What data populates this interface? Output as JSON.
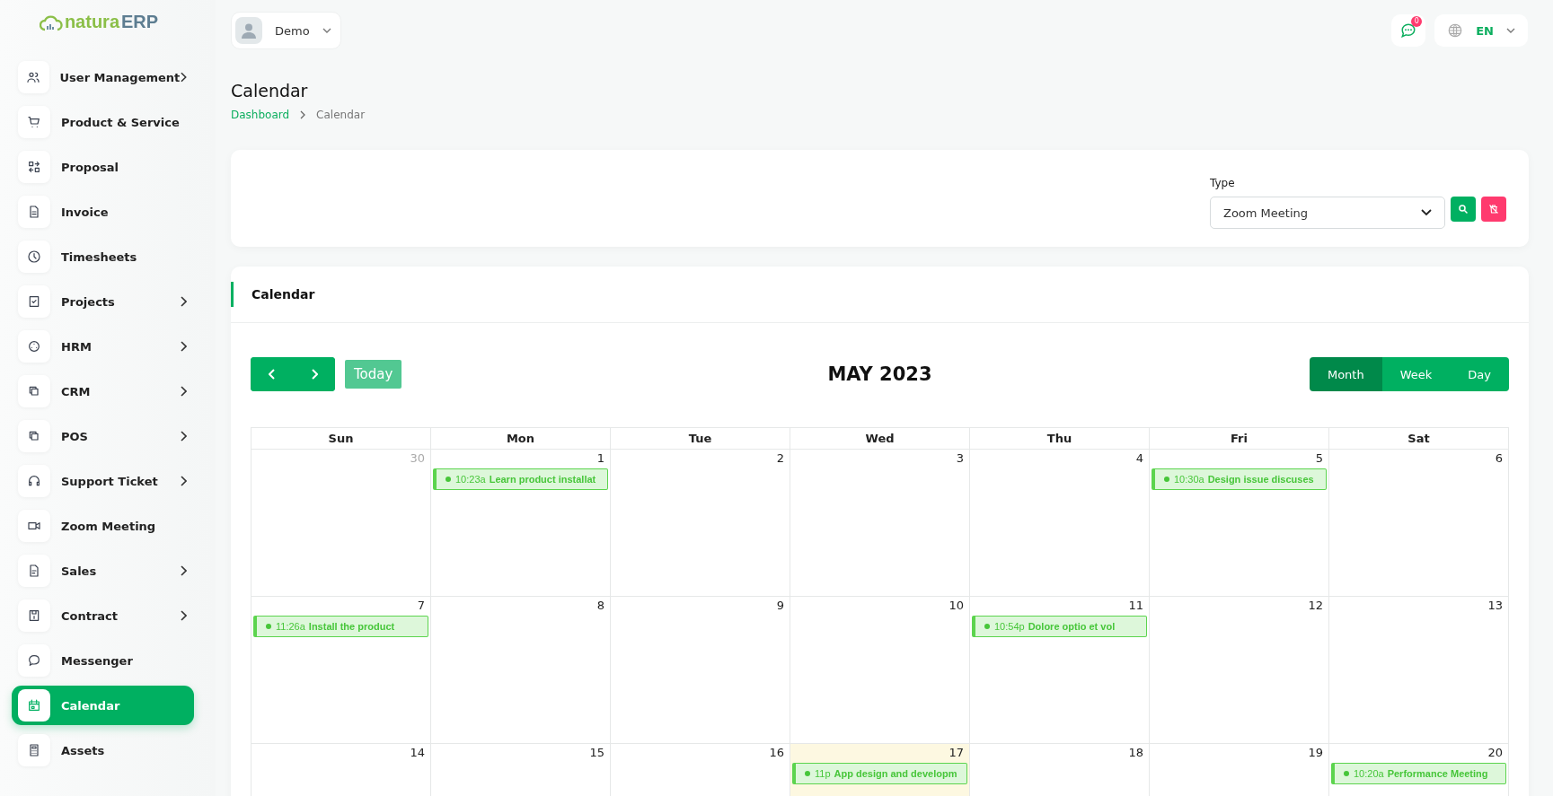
{
  "logo": {
    "part_a": "natura",
    "part_b": "ERP"
  },
  "user": {
    "name": "Demo"
  },
  "notifications": {
    "count": "0"
  },
  "language": {
    "code": "EN"
  },
  "sidebar": {
    "items": [
      {
        "label": "User Management",
        "has_submenu": true,
        "selected": false
      },
      {
        "label": "Product & Service",
        "has_submenu": false,
        "selected": false
      },
      {
        "label": "Proposal",
        "has_submenu": false,
        "selected": false
      },
      {
        "label": "Invoice",
        "has_submenu": false,
        "selected": false
      },
      {
        "label": "Timesheets",
        "has_submenu": false,
        "selected": false
      },
      {
        "label": "Projects",
        "has_submenu": true,
        "selected": false
      },
      {
        "label": "HRM",
        "has_submenu": true,
        "selected": false
      },
      {
        "label": "CRM",
        "has_submenu": true,
        "selected": false
      },
      {
        "label": "POS",
        "has_submenu": true,
        "selected": false
      },
      {
        "label": "Support Ticket",
        "has_submenu": true,
        "selected": false
      },
      {
        "label": "Zoom Meeting",
        "has_submenu": false,
        "selected": false
      },
      {
        "label": "Sales",
        "has_submenu": true,
        "selected": false
      },
      {
        "label": "Contract",
        "has_submenu": true,
        "selected": false
      },
      {
        "label": "Messenger",
        "has_submenu": false,
        "selected": false
      },
      {
        "label": "Calendar",
        "has_submenu": false,
        "selected": true
      },
      {
        "label": "Assets",
        "has_submenu": false,
        "selected": false
      }
    ]
  },
  "page": {
    "title": "Calendar",
    "breadcrumb": [
      {
        "label": "Dashboard",
        "link": true
      },
      {
        "label": "Calendar",
        "link": false
      }
    ]
  },
  "filter": {
    "label": "Type",
    "value": "Zoom Meeting"
  },
  "calendar": {
    "card_title": "Calendar",
    "month_title": "MAY 2023",
    "today_label": "Today",
    "views": [
      {
        "label": "Month",
        "selected": true
      },
      {
        "label": "Week",
        "selected": false
      },
      {
        "label": "Day",
        "selected": false
      }
    ],
    "weekdays": [
      "Sun",
      "Mon",
      "Tue",
      "Wed",
      "Thu",
      "Fri",
      "Sat"
    ],
    "weeks": [
      [
        {
          "day": "30",
          "other_month": true,
          "today": false
        },
        {
          "day": "1",
          "other_month": false,
          "today": false,
          "events": [
            {
              "time": "10:23a",
              "title": "Learn product installat"
            }
          ]
        },
        {
          "day": "2",
          "other_month": false,
          "today": false
        },
        {
          "day": "3",
          "other_month": false,
          "today": false
        },
        {
          "day": "4",
          "other_month": false,
          "today": false
        },
        {
          "day": "5",
          "other_month": false,
          "today": false,
          "events": [
            {
              "time": "10:30a",
              "title": "Design issue discuses"
            }
          ]
        },
        {
          "day": "6",
          "other_month": false,
          "today": false
        }
      ],
      [
        {
          "day": "7",
          "other_month": false,
          "today": false,
          "events": [
            {
              "time": "11:26a",
              "title": "Install the product"
            }
          ]
        },
        {
          "day": "8",
          "other_month": false,
          "today": false
        },
        {
          "day": "9",
          "other_month": false,
          "today": false
        },
        {
          "day": "10",
          "other_month": false,
          "today": false
        },
        {
          "day": "11",
          "other_month": false,
          "today": false,
          "events": [
            {
              "time": "10:54p",
              "title": "Dolore optio et vol"
            }
          ]
        },
        {
          "day": "12",
          "other_month": false,
          "today": false
        },
        {
          "day": "13",
          "other_month": false,
          "today": false
        }
      ],
      [
        {
          "day": "14",
          "other_month": false,
          "today": false
        },
        {
          "day": "15",
          "other_month": false,
          "today": false
        },
        {
          "day": "16",
          "other_month": false,
          "today": false
        },
        {
          "day": "17",
          "other_month": false,
          "today": true,
          "events": [
            {
              "time": "11p",
              "title": "App design and developm"
            }
          ]
        },
        {
          "day": "18",
          "other_month": false,
          "today": false
        },
        {
          "day": "19",
          "other_month": false,
          "today": false
        },
        {
          "day": "20",
          "other_month": false,
          "today": false,
          "events": [
            {
              "time": "10:20a",
              "title": "Performance Meeting"
            }
          ]
        }
      ]
    ]
  }
}
